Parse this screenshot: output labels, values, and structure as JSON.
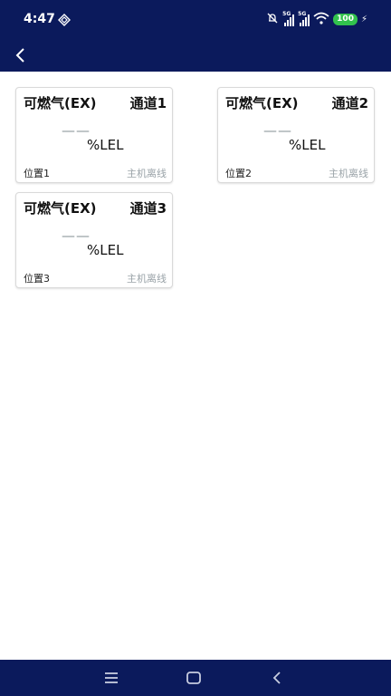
{
  "status_bar": {
    "time": "4:47",
    "network_label_1": "5G",
    "network_label_2": "5G",
    "battery": "100",
    "icons": [
      "cast-icon",
      "mute-icon",
      "signal-icon",
      "wifi-icon",
      "battery-icon",
      "charging-icon"
    ]
  },
  "app_bar": {
    "back_icon": "back-arrow-icon"
  },
  "cards": [
    {
      "gas": "可燃气(EX)",
      "channel": "通道1",
      "value": "——",
      "unit": "%LEL",
      "location": "位置1",
      "status": "主机离线"
    },
    {
      "gas": "可燃气(EX)",
      "channel": "通道2",
      "value": "——",
      "unit": "%LEL",
      "location": "位置2",
      "status": "主机离线"
    },
    {
      "gas": "可燃气(EX)",
      "channel": "通道3",
      "value": "——",
      "unit": "%LEL",
      "location": "位置3",
      "status": "主机离线"
    }
  ],
  "nav_bar": {
    "icons": [
      "menu-icon",
      "home-icon",
      "back-icon"
    ]
  },
  "colors": {
    "header": "#0b1a5c",
    "card_border": "#d9d9d9",
    "muted_text": "#9aa3a8",
    "battery": "#32c24d"
  }
}
